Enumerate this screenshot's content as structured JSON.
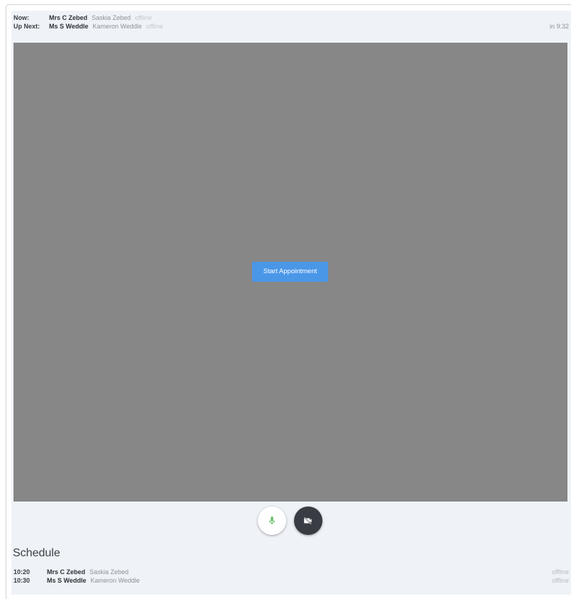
{
  "header": {
    "now": {
      "label": "Now:",
      "name": "Mrs C Zebed",
      "detail": "Saskia Zebed",
      "status": "offline"
    },
    "up_next": {
      "label": "Up Next:",
      "name": "Ms S Weddle",
      "detail": "Kameron Weddle",
      "status": "offline",
      "countdown": "in 9:32"
    }
  },
  "video": {
    "start_label": "Start Appointment"
  },
  "controls": {
    "mic_icon": "microphone-icon",
    "camera_icon": "video-off-icon",
    "mic_color": "#6abf69"
  },
  "schedule": {
    "title": "Schedule",
    "items": [
      {
        "time": "10:20",
        "name": "Mrs C Zebed",
        "detail": "Saskia Zebed",
        "status": "offline"
      },
      {
        "time": "10:30",
        "name": "Ms S Weddle",
        "detail": "Kameron Weddle",
        "status": "offline"
      }
    ]
  },
  "colors": {
    "accent": "#4a97e8",
    "video_bg": "#878788",
    "panel_bg": "#eff2f7"
  }
}
